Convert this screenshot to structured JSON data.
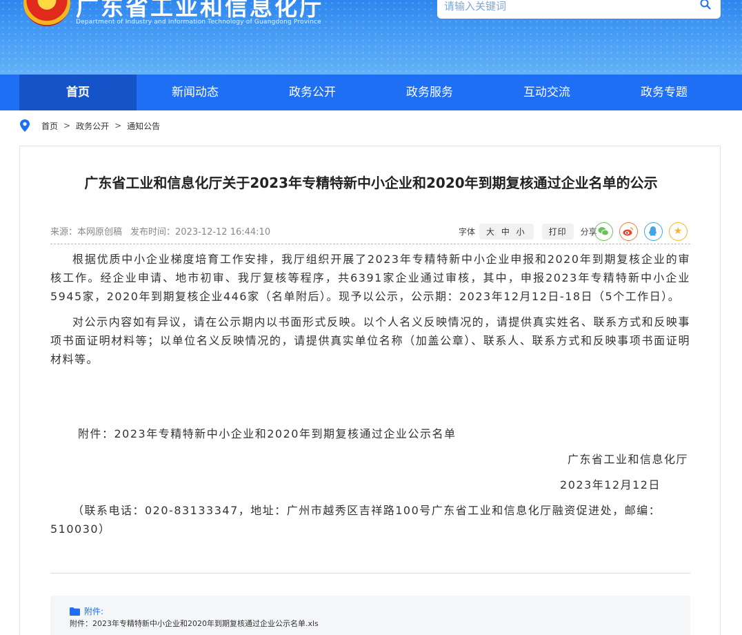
{
  "header": {
    "title": "广东省工业和信息化厅",
    "subtitle": "Department of Industry and Information Technology of Guangdong Province",
    "search_placeholder": "请输入关键词"
  },
  "nav": {
    "items": [
      {
        "label": "首页",
        "active": true
      },
      {
        "label": "新闻动态"
      },
      {
        "label": "政务公开"
      },
      {
        "label": "政务服务"
      },
      {
        "label": "互动交流"
      },
      {
        "label": "政务专题"
      }
    ]
  },
  "breadcrumb": [
    "首页",
    "政务公开",
    "通知公告"
  ],
  "article": {
    "title": "广东省工业和信息化厅关于2023年专精特新中小企业和2020年到期复核通过企业名单的公示",
    "source_label": "来源：本网原创稿",
    "time_label": "发布时间：",
    "time": "2023-12-12 16:44:10",
    "font_label": "字体",
    "font_sizes": "大 中 小",
    "print_label": "打印",
    "share_label": "分享",
    "paragraphs": [
      "根据优质中小企业梯度培育工作安排，我厅组织开展了2023年专精特新中小企业申报和2020年到期复核企业的审核工作。经企业申请、地市初审、我厅复核等程序，共6391家企业通过审核，其中，申报2023年专精特新中小企业5945家，2020年到期复核企业446家（名单附后）。现予以公示，公示期：2023年12月12日-18日（5个工作日）。",
      "对公示内容如有异议，请在公示期内以书面形式反映。以个人名义反映情况的，请提供真实姓名、联系方式和反映事项书面证明材料等；以单位名义反映情况的，请提供真实单位名称（加盖公章）、联系人、联系方式和反映事项书面证明材料等。"
    ],
    "attachment_line": "附件：2023年专精特新中小企业和2020年到期复核通过企业公示名单",
    "sign_org": "广东省工业和信息化厅",
    "sign_date": "2023年12月12日",
    "contact": "（联系电话：020-83133347，地址：广州市越秀区吉祥路100号广东省工业和信息化厅融资促进处，邮编：510030）"
  },
  "attachments": {
    "head": "附件:",
    "file": "附件：2023年专精特新中小企业和2020年到期复核通过企业公示名单.xls"
  },
  "colors": {
    "nav": "#1f6ff5",
    "nav_active": "#1554c8",
    "banner": "#4aa0f5"
  }
}
